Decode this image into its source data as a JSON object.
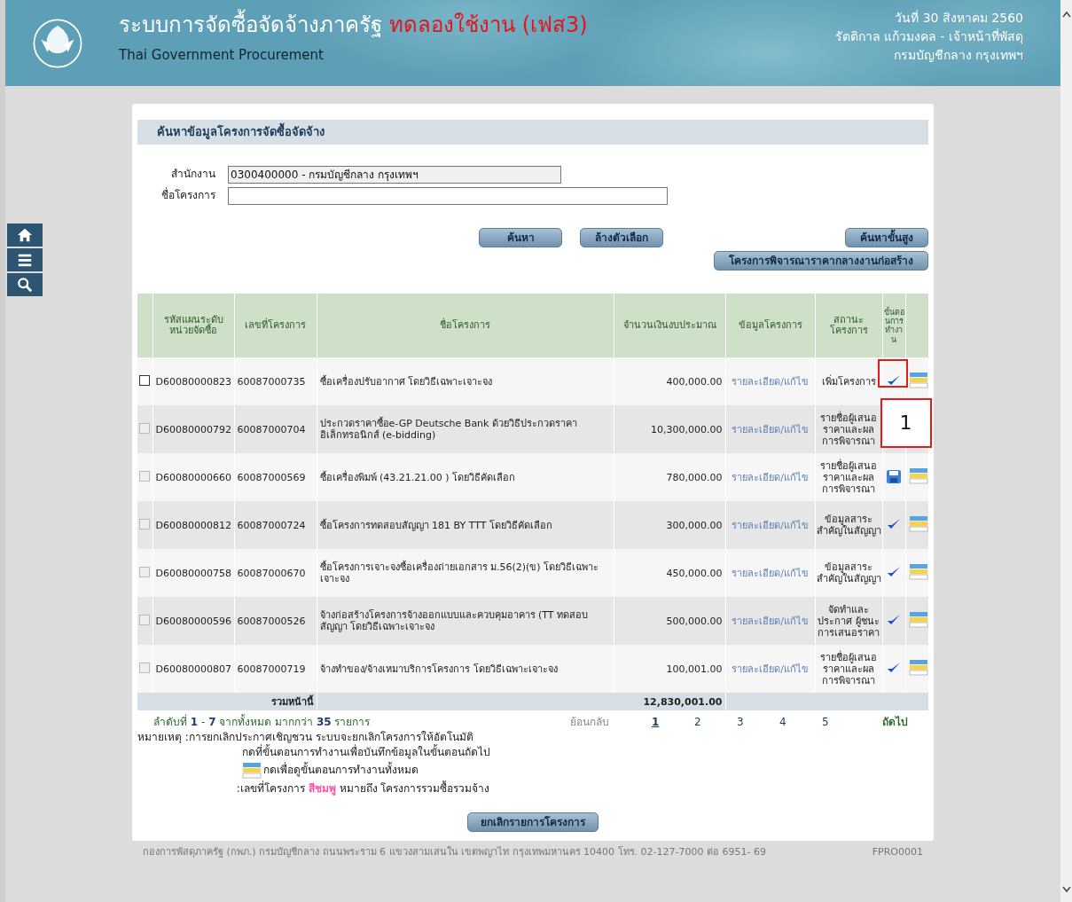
{
  "header": {
    "title": "ระบบการจัดซื้อจัดจ้างภาครัฐ",
    "title_tag": "ทดลองใช้งาน (เฟส3)",
    "subtitle": "Thai Government Procurement",
    "date": "วันที่ 30 สิงหาคม 2560",
    "user": "รัตติกาล แก้วมงคล - เจ้าหน้าที่พัสดุ",
    "org": "กรมบัญชีกลาง กรุงเทพฯ"
  },
  "side_nav": [
    {
      "kind": "home"
    },
    {
      "kind": "menu"
    },
    {
      "kind": "search"
    }
  ],
  "search_panel": {
    "title": "ค้นหาข้อมูลโครงการจัดซื้อจัดจ้าง",
    "fields": [
      {
        "label": "สำนักงาน",
        "value": "0300400000 - กรมบัญชีกลาง กรุงเทพฯ",
        "disabled": true
      },
      {
        "label": "ชื่อโครงการ",
        "disabled": false
      }
    ],
    "buttons": [
      "ค้นหา",
      "ล้างตัวเลือก"
    ],
    "advanced_button": "ค้นหาขั้นสูง",
    "construction_button": "โครงการพิจารณาราคากลางงานก่อสร้าง"
  },
  "table": {
    "columns": [
      "รหัสแผนระดับหน่วยจัดซื้อ",
      "เลขที่โครงการ",
      "ชื่อโครงการ",
      "จำนวนเงินงบประมาณ",
      "ข้อมูลโครงการ",
      "สถานะโครงการ",
      "ขั้นตอนการทำงาน"
    ],
    "rows": [
      {
        "checked": false,
        "disabled": false,
        "plan_code": "D60080000823",
        "project_no": "60087000735",
        "name": "ซื้อเครื่องปรับอากาศ โดยวิธีเฉพาะเจาะจง",
        "amount": "400,000.00",
        "info_link": "รายละเอียด/แก้ไข",
        "status": "เพิ่มโครงการ",
        "step": {
          "kind": "check"
        },
        "callout": "1"
      },
      {
        "checked": false,
        "disabled": true,
        "plan_code": "D60080000792",
        "project_no": "60087000704",
        "name": "ประกวดราคาซื้อe-GP Deutsche Bank ด้วยวิธีประกวดราคาอิเล็กทรอนิกส์ (e-bidding)",
        "amount": "10,300,000.00",
        "info_link": "รายละเอียด/แก้ไข",
        "status": "รายชื่อผู้เสนอราคาและผลการพิจารณา"
      },
      {
        "checked": false,
        "disabled": true,
        "plan_code": "D60080000660",
        "project_no": "60087000569",
        "name": "ซื้อเครื่องพิมพ์ (43.21.21.00 ) โดยวิธีคัดเลือก",
        "amount": "780,000.00",
        "info_link": "รายละเอียด/แก้ไข",
        "status": "รายชื่อผู้เสนอราคาและผลการพิจารณา",
        "step": {
          "kind": "save"
        }
      },
      {
        "checked": false,
        "disabled": true,
        "plan_code": "D60080000812",
        "project_no": "60087000724",
        "name": "ซื้อโครงการทดสอบสัญญา 181 BY TTT โดยวิธีคัดเลือก",
        "amount": "300,000.00",
        "info_link": "รายละเอียด/แก้ไข",
        "status": "ข้อมูลสาระสำคัญในสัญญา",
        "step": {
          "kind": "check"
        }
      },
      {
        "checked": false,
        "disabled": true,
        "plan_code": "D60080000758",
        "project_no": "60087000670",
        "name": "ซื้อโครงการเจาะจงซื้อเครื่องถ่ายเอกสาร ม.56(2)(ข) โดยวิธีเฉพาะเจาะจง",
        "amount": "450,000.00",
        "info_link": "รายละเอียด/แก้ไข",
        "status": "ข้อมูลสาระสำคัญในสัญญา",
        "step": {
          "kind": "check"
        }
      },
      {
        "checked": false,
        "disabled": true,
        "plan_code": "D60080000596",
        "project_no": "60087000526",
        "name": "จ้างก่อสร้างโครงการจ้างออกแบบและควบคุมอาคาร (TT ทดสอบสัญญา โดยวิธีเฉพาะเจาะจง",
        "amount": "500,000.00",
        "info_link": "รายละเอียด/แก้ไข",
        "status": "จัดทำและประกาศ ผู้ชนะการเสนอราคา",
        "step": {
          "kind": "check"
        }
      },
      {
        "checked": false,
        "disabled": true,
        "plan_code": "D60080000807",
        "project_no": "60087000719",
        "name": "จ้างทำของ/จ้างเหมาบริการโครงการ โดยวิธีเฉพาะเจาะจง",
        "amount": "100,001.00",
        "info_link": "รายละเอียด/แก้ไข",
        "status": "รายชื่อผู้เสนอราคาและผลการพิจารณา",
        "step": {
          "kind": "check"
        }
      }
    ],
    "total_label": "รวมหน้านี้",
    "total_amount": "12,830,001.00"
  },
  "pagination": {
    "summary": "ลำดับที่ **1** - **7** จากทั้งหมด มากกว่า **35** รายการ",
    "prev": "ย้อนกลับ",
    "pages": [
      {
        "label": "1",
        "selected": true
      },
      {
        "label": "2",
        "selected": false
      },
      {
        "label": "3",
        "selected": false
      },
      {
        "label": "4",
        "selected": false
      },
      {
        "label": "5",
        "selected": false
      }
    ],
    "next": "ถัดไป"
  },
  "notes": {
    "label": "หมายเหตุ :",
    "lines": [
      {
        "kind": "text",
        "text": "การยกเลิกประกาศเชิญชวน ระบบจะยกเลิกโครงการให้อัตโนมัติ"
      },
      {
        "kind": "text",
        "text": "กดที่ขั้นตอนการทำงานเพื่อบันทึกข้อมูลในขั้นตอนถัดไป"
      },
      {
        "kind": "icon",
        "text": "กดเพื่อดูขั้นตอนการทำงานทั้งหมด"
      },
      {
        "kind": "text",
        "text": ":เลขที่โครงการ **สีชมพู** หมายถึง โครงการรวมซื้อรวมจ้าง"
      }
    ]
  },
  "cancel_button": "ยกเลิกรายการโครงการ",
  "footer": {
    "address": "กองการพัสดุภาครัฐ (กพภ.) กรมบัญชีกลาง ถนนพระราม 6 แขวงสามเสนใน เขตพญาไท กรุงเทพมหานคร 10400 โทร. 02-127-7000 ต่อ 6951- 69",
    "code": "FPRO0001"
  }
}
